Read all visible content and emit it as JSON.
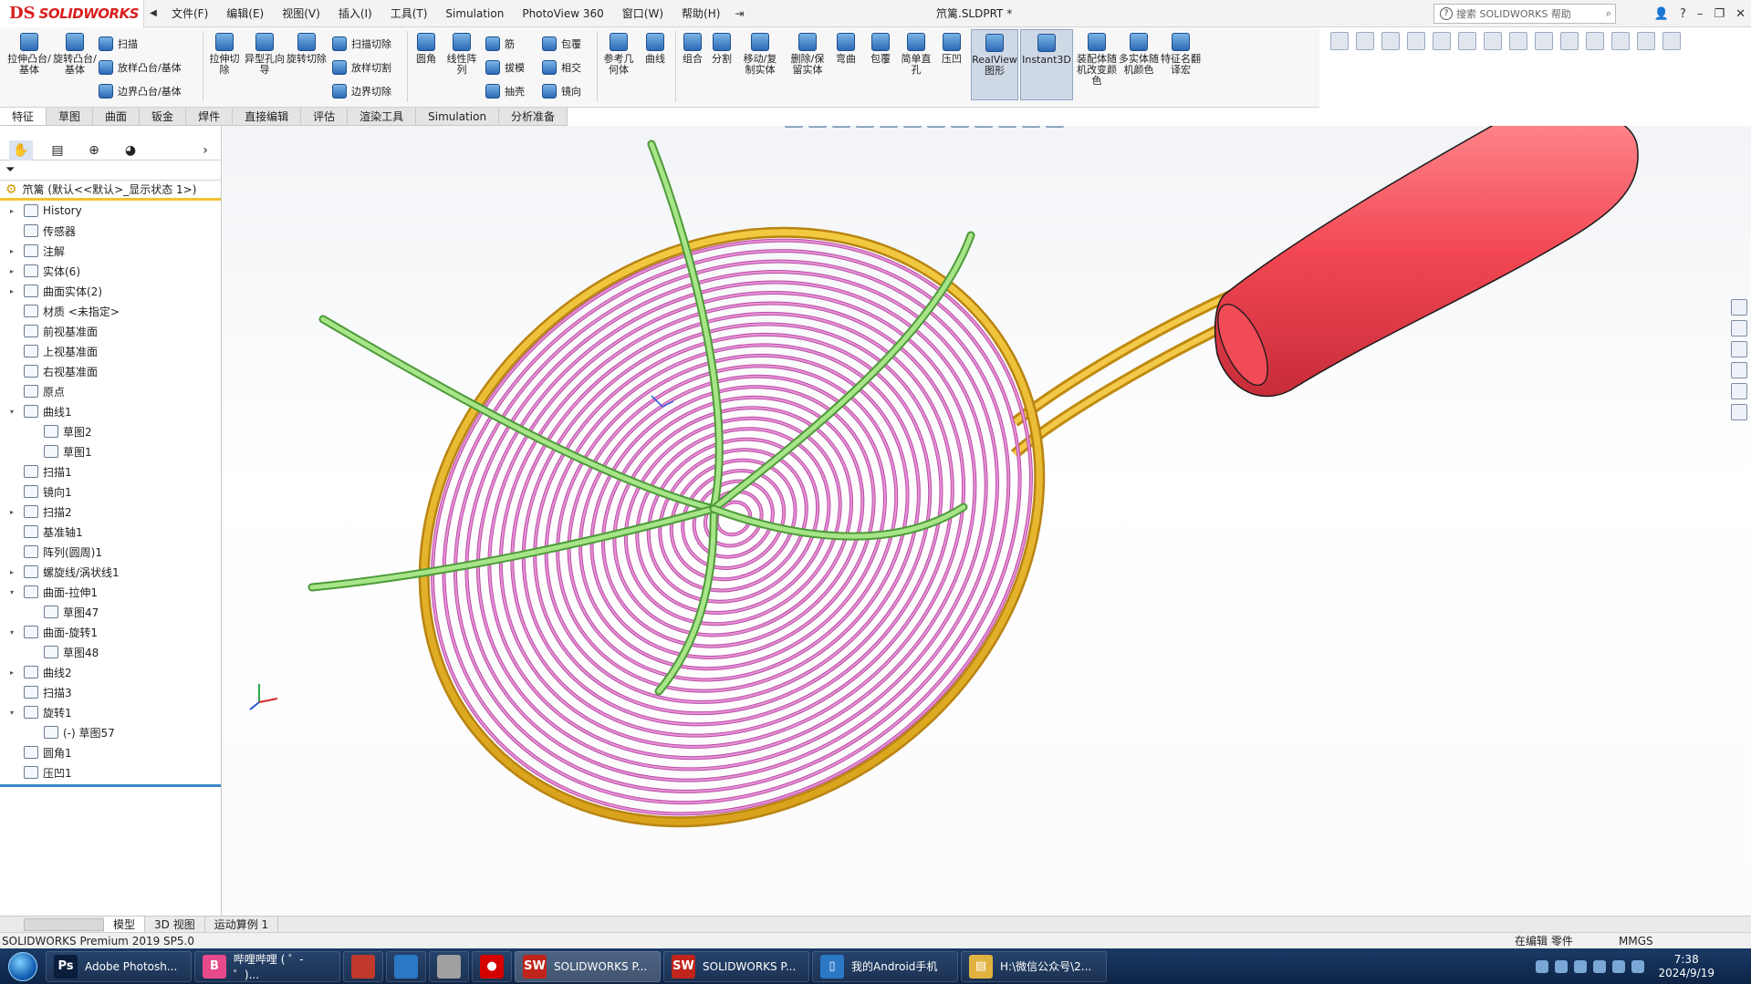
{
  "window": {
    "logo_mark": "DS",
    "logo_text": "SOLIDWORKS",
    "document_title": "笊篱.SLDPRT *",
    "help_search_placeholder": "搜索 SOLIDWORKS 帮助"
  },
  "menu": [
    "文件(F)",
    "编辑(E)",
    "视图(V)",
    "插入(I)",
    "工具(T)",
    "Simulation",
    "PhotoView 360",
    "窗口(W)",
    "帮助(H)"
  ],
  "commands": {
    "extrude_boss": "拉伸凸台/基体",
    "revolve_boss": "旋转凸台/基体",
    "sweep": "扫描",
    "loft_boss": "放样凸台/基体",
    "boundary_boss": "边界凸台/基体",
    "extrude_cut": "拉伸切除",
    "hole_wizard": "异型孔向导",
    "revolve_cut": "旋转切除",
    "swept_cut": "扫描切除",
    "lofted_cut": "放样切割",
    "boundary_cut": "边界切除",
    "fillet": "圆角",
    "linear_pattern": "线性阵列",
    "rib": "筋",
    "draft": "拔模",
    "shell": "抽壳",
    "wrap": "包覆",
    "intersect": "相交",
    "mirror": "镜向",
    "ref_geometry": "参考几何体",
    "curves": "曲线",
    "combine": "组合",
    "split": "分割",
    "move_copy": "移动/复制实体",
    "delete_keep": "删除/保留实体",
    "flex": "弯曲",
    "wrap2": "包覆",
    "simple_hole": "简单直孔",
    "indent": "压凹",
    "realview": "RealView图形",
    "instant3d": "Instant3D",
    "assembly_color": "装配体随机改变颜色",
    "multibody_color": "多实体随机颜色",
    "feature_rename": "特征名翻译宏"
  },
  "tabs": [
    "特征",
    "草图",
    "曲面",
    "钣金",
    "焊件",
    "直接编辑",
    "评估",
    "渲染工具",
    "Simulation",
    "分析准备"
  ],
  "tree": {
    "root": "笊篱 (默认<<默认>_显示状态 1>)",
    "items": [
      {
        "label": "History",
        "level": 1,
        "expand": "▸"
      },
      {
        "label": "传感器",
        "level": 1,
        "expand": ""
      },
      {
        "label": "注解",
        "level": 1,
        "expand": "▸"
      },
      {
        "label": "实体(6)",
        "level": 1,
        "expand": "▸"
      },
      {
        "label": "曲面实体(2)",
        "level": 1,
        "expand": "▸"
      },
      {
        "label": "材质 <未指定>",
        "level": 1,
        "expand": ""
      },
      {
        "label": "前视基准面",
        "level": 1,
        "expand": ""
      },
      {
        "label": "上视基准面",
        "level": 1,
        "expand": ""
      },
      {
        "label": "右视基准面",
        "level": 1,
        "expand": ""
      },
      {
        "label": "原点",
        "level": 1,
        "expand": ""
      },
      {
        "label": "曲线1",
        "level": 1,
        "expand": "▾"
      },
      {
        "label": "草图2",
        "level": 2,
        "expand": ""
      },
      {
        "label": "草图1",
        "level": 2,
        "expand": ""
      },
      {
        "label": "扫描1",
        "level": 1,
        "expand": ""
      },
      {
        "label": "镜向1",
        "level": 1,
        "expand": ""
      },
      {
        "label": "扫描2",
        "level": 1,
        "expand": "▸"
      },
      {
        "label": "基准轴1",
        "level": 1,
        "expand": ""
      },
      {
        "label": "阵列(圆周)1",
        "level": 1,
        "expand": ""
      },
      {
        "label": "螺旋线/涡状线1",
        "level": 1,
        "expand": "▸"
      },
      {
        "label": "曲面-拉伸1",
        "level": 1,
        "expand": "▾"
      },
      {
        "label": "草图47",
        "level": 2,
        "expand": ""
      },
      {
        "label": "曲面-旋转1",
        "level": 1,
        "expand": "▾"
      },
      {
        "label": "草图48",
        "level": 2,
        "expand": ""
      },
      {
        "label": "曲线2",
        "level": 1,
        "expand": "▸"
      },
      {
        "label": "扫描3",
        "level": 1,
        "expand": ""
      },
      {
        "label": "旋转1",
        "level": 1,
        "expand": "▾"
      },
      {
        "label": "(-) 草图57",
        "level": 2,
        "expand": ""
      },
      {
        "label": "圆角1",
        "level": 1,
        "expand": ""
      },
      {
        "label": "压凹1",
        "level": 1,
        "expand": ""
      }
    ]
  },
  "bottom_tabs": [
    "模型",
    "3D 视图",
    "运动算例 1"
  ],
  "status": {
    "product": "SOLIDWORKS Premium 2019 SP5.0",
    "editing": "在编辑 零件",
    "units": "MMGS"
  },
  "taskbar": {
    "items": [
      {
        "label": "Adobe Photosh...",
        "icon": "Ps",
        "color": "#0a1e3c"
      },
      {
        "label": "哔哩哔哩 ( ゜- ゜)...",
        "icon": "B",
        "color": "#e64a8a"
      },
      {
        "label": "",
        "icon": "",
        "color": "#c0392b"
      },
      {
        "label": "",
        "icon": "",
        "color": "#2b78c5"
      },
      {
        "label": "",
        "icon": "",
        "color": "#a0a0a0"
      },
      {
        "label": "",
        "icon": "●",
        "color": "#d40000"
      },
      {
        "label": "SOLIDWORKS P...",
        "icon": "SW",
        "color": "#c0241b"
      },
      {
        "label": "SOLIDWORKS P...",
        "icon": "SW",
        "color": "#c0241b"
      },
      {
        "label": "我的Android手机",
        "icon": "▯",
        "color": "#2b78c5"
      },
      {
        "label": "H:\\微信公众号\\2...",
        "icon": "▤",
        "color": "#e0b341"
      }
    ],
    "time": "7:38",
    "date": "2024/9/19"
  },
  "colors": {
    "rim": "#e8b62a",
    "mesh": "#d872c0",
    "ribs": "#86d36a",
    "handle": "#f4505a",
    "accent": "#d8201f"
  }
}
